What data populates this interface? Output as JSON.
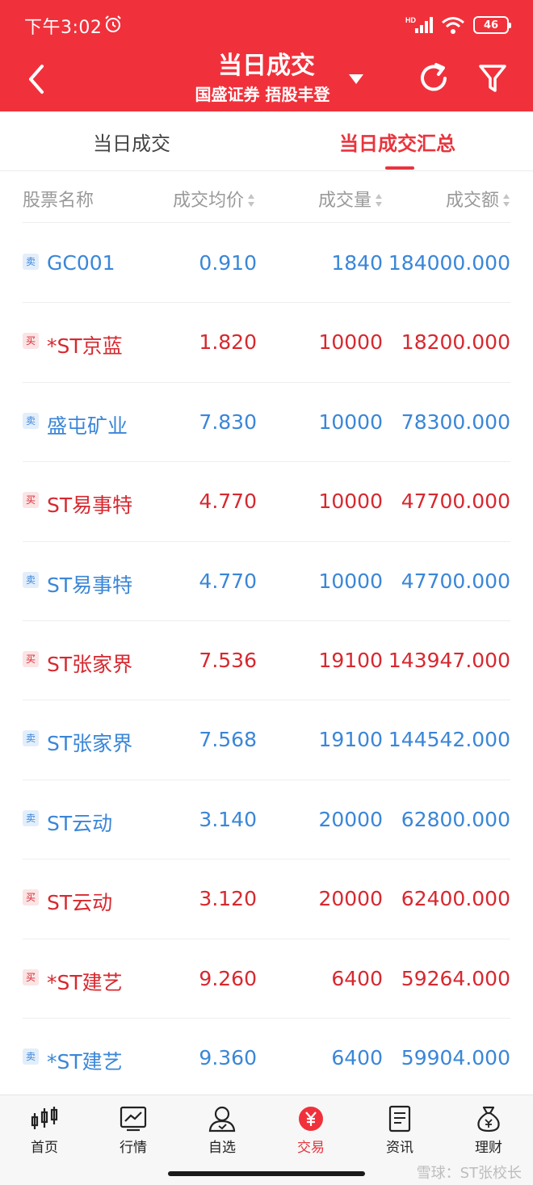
{
  "status_bar": {
    "time": "下午3:02",
    "network": "HD",
    "battery": "46"
  },
  "header": {
    "title": "当日成交",
    "subtitle": "国盛证券 捂股丰登"
  },
  "tabs": [
    {
      "label": "当日成交"
    },
    {
      "label": "当日成交汇总"
    }
  ],
  "columns": {
    "name": "股票名称",
    "price": "成交均价",
    "volume": "成交量",
    "amount": "成交额"
  },
  "rows": [
    {
      "side": "卖",
      "name": "GC001",
      "price": "0.910",
      "volume": "1840",
      "amount": "184000.000"
    },
    {
      "side": "买",
      "name": "*ST京蓝",
      "price": "1.820",
      "volume": "10000",
      "amount": "18200.000"
    },
    {
      "side": "卖",
      "name": "盛屯矿业",
      "price": "7.830",
      "volume": "10000",
      "amount": "78300.000"
    },
    {
      "side": "买",
      "name": "ST易事特",
      "price": "4.770",
      "volume": "10000",
      "amount": "47700.000"
    },
    {
      "side": "卖",
      "name": "ST易事特",
      "price": "4.770",
      "volume": "10000",
      "amount": "47700.000"
    },
    {
      "side": "买",
      "name": "ST张家界",
      "price": "7.536",
      "volume": "19100",
      "amount": "143947.000"
    },
    {
      "side": "卖",
      "name": "ST张家界",
      "price": "7.568",
      "volume": "19100",
      "amount": "144542.000"
    },
    {
      "side": "卖",
      "name": "ST云动",
      "price": "3.140",
      "volume": "20000",
      "amount": "62800.000"
    },
    {
      "side": "买",
      "name": "ST云动",
      "price": "3.120",
      "volume": "20000",
      "amount": "62400.000"
    },
    {
      "side": "买",
      "name": "*ST建艺",
      "price": "9.260",
      "volume": "6400",
      "amount": "59264.000"
    },
    {
      "side": "卖",
      "name": "*ST建艺",
      "price": "9.360",
      "volume": "6400",
      "amount": "59904.000"
    }
  ],
  "nav": [
    {
      "label": "首页",
      "icon": "candlestick-icon"
    },
    {
      "label": "行情",
      "icon": "chart-icon"
    },
    {
      "label": "自选",
      "icon": "user-icon"
    },
    {
      "label": "交易",
      "icon": "yen-icon"
    },
    {
      "label": "资讯",
      "icon": "document-icon"
    },
    {
      "label": "理财",
      "icon": "money-bag-icon"
    }
  ],
  "watermark": "雪球：ST张校长",
  "colors": {
    "primary": "#f0313b",
    "buy": "#d7282f",
    "sell": "#3a86d8"
  }
}
